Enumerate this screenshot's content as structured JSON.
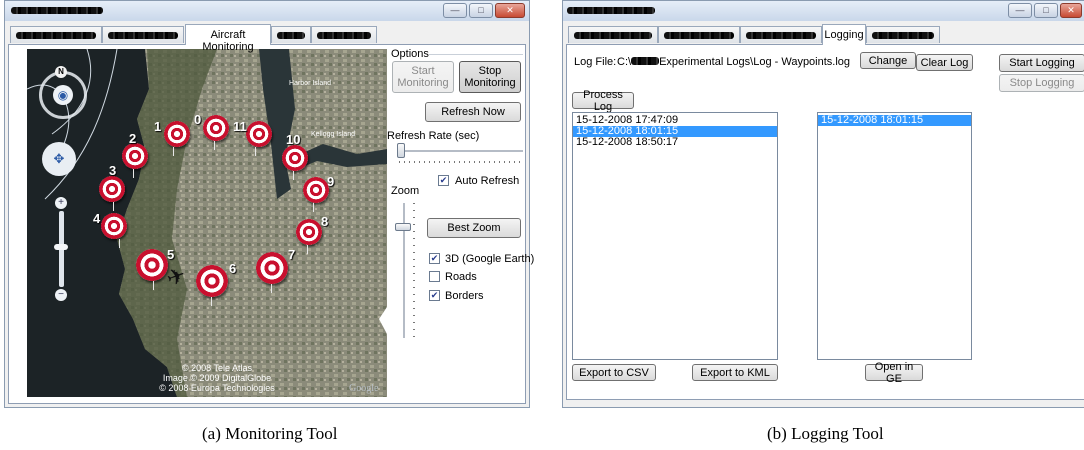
{
  "monitoring": {
    "active_tab": "Aircraft Monitoring",
    "options": {
      "title": "Options",
      "start_monitoring": "Start Monitoring",
      "stop_monitoring": "Stop Monitoring",
      "refresh_now": "Refresh Now",
      "refresh_rate_label": "Refresh Rate (sec)",
      "auto_refresh": {
        "label": "Auto Refresh",
        "checked": true
      },
      "zoom_label": "Zoom",
      "best_zoom": "Best Zoom",
      "earth_3d": {
        "label": "3D (Google Earth)",
        "checked": true
      },
      "roads": {
        "label": "Roads",
        "checked": false
      },
      "borders": {
        "label": "Borders",
        "checked": true
      }
    },
    "map": {
      "labels": {
        "harbor": "Harbor Island",
        "kellogg": "Kellogg Island",
        "compass": "N"
      },
      "waypoints": [
        "0",
        "1",
        "2",
        "3",
        "4",
        "5",
        "6",
        "7",
        "8",
        "9",
        "10",
        "11"
      ],
      "attribution": [
        "© 2008 Tele Atlas",
        "Image © 2009 DigitalGlobe",
        "© 2008 Europa Technologies"
      ],
      "brand": "Google"
    },
    "caption": "(a)  Monitoring Tool"
  },
  "logging": {
    "active_tab": "Logging",
    "log_file_label": "Log File:",
    "log_file_value_prefix": "C:\\",
    "log_file_value_suffix": "Experimental Logs\\Log - Waypoints.log",
    "change": "Change",
    "clear_log": "Clear Log",
    "start_logging": "Start Logging",
    "stop_logging": "Stop Logging",
    "process_log": "Process Log",
    "log_entries": [
      "15-12-2008 17:47:09",
      "15-12-2008 18:01:15",
      "15-12-2008 18:50:17"
    ],
    "selected_entry_index": 1,
    "processed_entries": [
      "15-12-2008 18:01:15"
    ],
    "export_csv": "Export to CSV",
    "export_kml": "Export to KML",
    "open_in_ge": "Open in GE",
    "caption": "(b)  Logging Tool"
  }
}
